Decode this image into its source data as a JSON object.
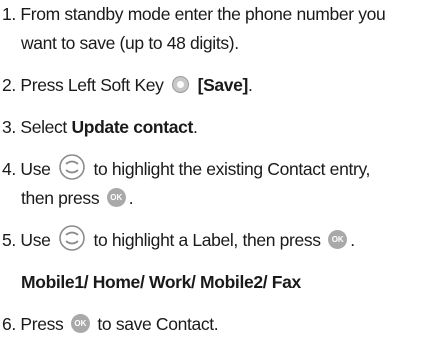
{
  "step1": {
    "line1": "1. From standby mode enter the phone number you",
    "line2": "want to save (up to 48 digits)."
  },
  "step2": {
    "pre": "2. Press Left Soft Key",
    "bold": "[Save]",
    "post": ".",
    "icon": "left-soft-key-icon"
  },
  "step3": {
    "pre": "3. Select ",
    "bold": "Update contact",
    "post": "."
  },
  "step4": {
    "pre": "4. Use",
    "mid": "to highlight the existing Contact entry,",
    "line2_pre": "then press",
    "line2_post": ".",
    "icons": [
      "navigation-key-icon",
      "ok-key-icon"
    ]
  },
  "step5": {
    "pre": "5. Use",
    "mid": "to highlight a Label, then press",
    "post": ".",
    "icons": [
      "navigation-key-icon",
      "ok-key-icon"
    ]
  },
  "labels_line": "Mobile1/ Home/ Work/ Mobile2/ Fax",
  "step6": {
    "pre": "6. Press",
    "post": "to save Contact.",
    "icon": "ok-key-icon"
  },
  "ok_text": "OK",
  "colors": {
    "text": "#1a1a1a",
    "icon_gray": "#a9a9a9"
  }
}
